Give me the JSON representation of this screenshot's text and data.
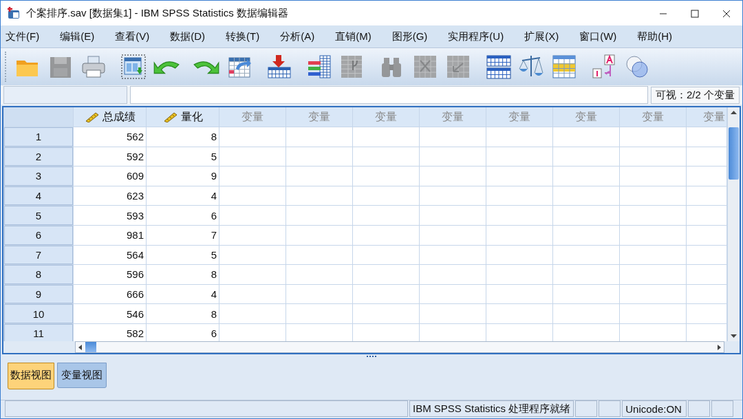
{
  "window": {
    "title": "个案排序.sav [数据集1] - IBM SPSS Statistics 数据编辑器"
  },
  "menu": [
    "文件(F)",
    "编辑(E)",
    "查看(V)",
    "数据(D)",
    "转换(T)",
    "分析(A)",
    "直销(M)",
    "图形(G)",
    "实用程序(U)",
    "扩展(X)",
    "窗口(W)",
    "帮助(H)"
  ],
  "toolbar": [
    {
      "kind": "open",
      "disabled": false
    },
    {
      "kind": "save",
      "disabled": true
    },
    {
      "kind": "print",
      "disabled": false
    },
    {
      "kind": "recall",
      "disabled": false
    },
    {
      "kind": "undo",
      "disabled": false
    },
    {
      "kind": "redo",
      "disabled": false
    },
    {
      "kind": "goto-case",
      "disabled": false
    },
    {
      "kind": "insert-case",
      "disabled": false
    },
    {
      "kind": "insert-variable",
      "disabled": false
    },
    {
      "kind": "split",
      "disabled": true
    },
    {
      "kind": "find",
      "disabled": true
    },
    {
      "kind": "grid-x",
      "disabled": true
    },
    {
      "kind": "grid-check",
      "disabled": true
    },
    {
      "kind": "split-file",
      "disabled": false
    },
    {
      "kind": "weight",
      "disabled": false
    },
    {
      "kind": "select",
      "disabled": false
    },
    {
      "kind": "labels",
      "disabled": false
    },
    {
      "kind": "sets",
      "disabled": false
    }
  ],
  "cell_editor": {
    "visible_count": "可视：2/2 个变量"
  },
  "columns": [
    {
      "label": "总成绩",
      "kind": "variable"
    },
    {
      "label": "量化",
      "kind": "variable"
    },
    {
      "label": "变量",
      "kind": "empty"
    },
    {
      "label": "变量",
      "kind": "empty"
    },
    {
      "label": "变量",
      "kind": "empty"
    },
    {
      "label": "变量",
      "kind": "empty"
    },
    {
      "label": "变量",
      "kind": "empty"
    },
    {
      "label": "变量",
      "kind": "empty"
    },
    {
      "label": "变量",
      "kind": "empty"
    },
    {
      "label": "变量",
      "kind": "empty"
    }
  ],
  "rows": [
    {
      "number": "1",
      "cells": [
        "562",
        "8"
      ]
    },
    {
      "number": "2",
      "cells": [
        "592",
        "5"
      ]
    },
    {
      "number": "3",
      "cells": [
        "609",
        "9"
      ]
    },
    {
      "number": "4",
      "cells": [
        "623",
        "4"
      ]
    },
    {
      "number": "5",
      "cells": [
        "593",
        "6"
      ]
    },
    {
      "number": "6",
      "cells": [
        "981",
        "7"
      ]
    },
    {
      "number": "7",
      "cells": [
        "564",
        "5"
      ]
    },
    {
      "number": "8",
      "cells": [
        "596",
        "8"
      ]
    },
    {
      "number": "9",
      "cells": [
        "666",
        "4"
      ]
    },
    {
      "number": "10",
      "cells": [
        "546",
        "8"
      ]
    },
    {
      "number": "11",
      "cells": [
        "582",
        "6"
      ]
    }
  ],
  "view_tabs": [
    {
      "label": "数据视图",
      "selected": true
    },
    {
      "label": "变量视图",
      "selected": false
    }
  ],
  "status_bar": {
    "message": "IBM SPSS Statistics 处理程序就绪",
    "unicode": "Unicode:ON"
  }
}
